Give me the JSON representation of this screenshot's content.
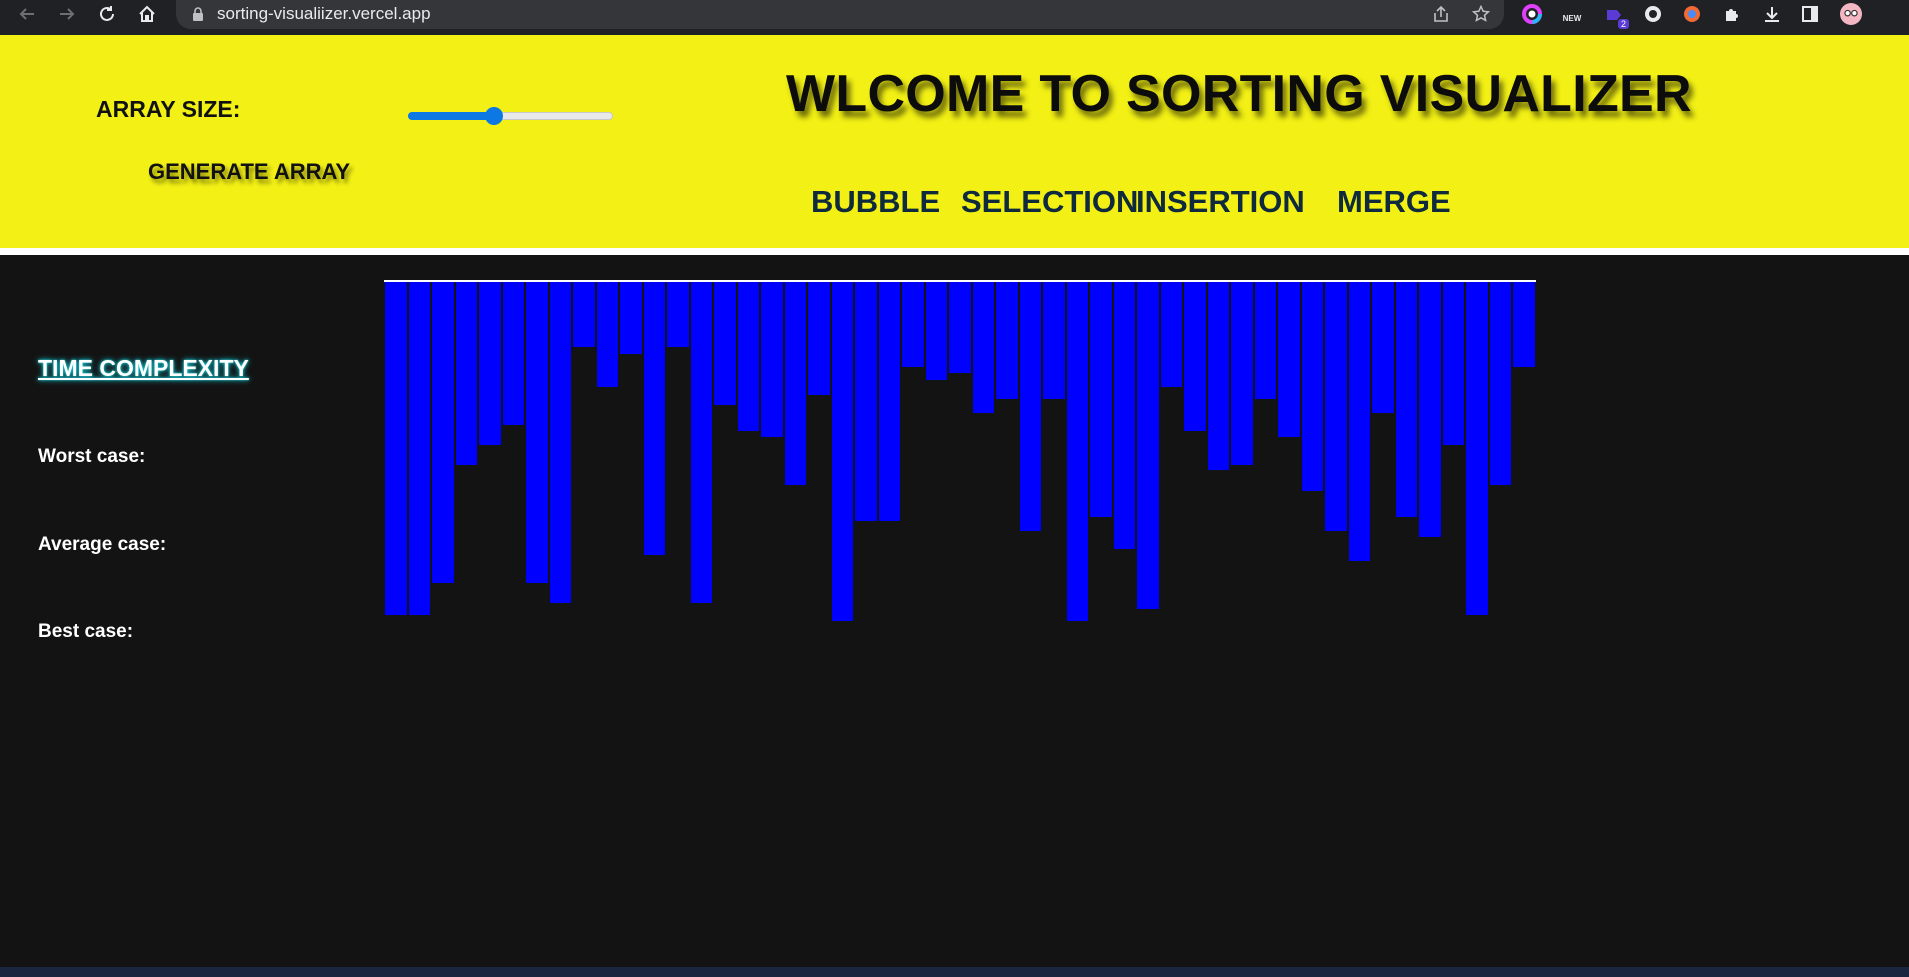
{
  "browser": {
    "url": "sorting-visualiizer.vercel.app",
    "extension_badge": "2",
    "new_badge": "NEW"
  },
  "header": {
    "array_size_label": "ARRAY SIZE:",
    "array_size_value_fraction": 0.42,
    "generate_button": "GENERATE ARRAY",
    "title": "WLCOME TO SORTING VISUALIZER",
    "algorithms": [
      "BUBBLE",
      "SELECTION",
      "INSERTION",
      "MERGE"
    ]
  },
  "sidebar": {
    "heading": "TIME COMPLEXITY",
    "worst": "Worst case:",
    "average": "Average case:",
    "best": "Best case:"
  },
  "colors": {
    "header_bg": "#f2f014",
    "page_bg": "#131313",
    "bar": "#0000ff",
    "slider": "#0b78e3",
    "heading_glow": "#19d6e3"
  },
  "array": {
    "values": [
      333,
      333,
      301,
      183,
      163,
      143,
      301,
      321,
      65,
      105,
      72,
      273,
      65,
      321,
      123,
      149,
      155,
      203,
      113,
      339,
      239,
      239,
      85,
      98,
      91,
      131,
      117,
      249,
      117,
      339,
      235,
      267,
      327,
      105,
      149,
      188,
      183,
      117,
      155,
      209,
      249,
      279,
      131,
      235,
      255,
      163,
      333,
      203,
      85
    ],
    "max": 360
  }
}
